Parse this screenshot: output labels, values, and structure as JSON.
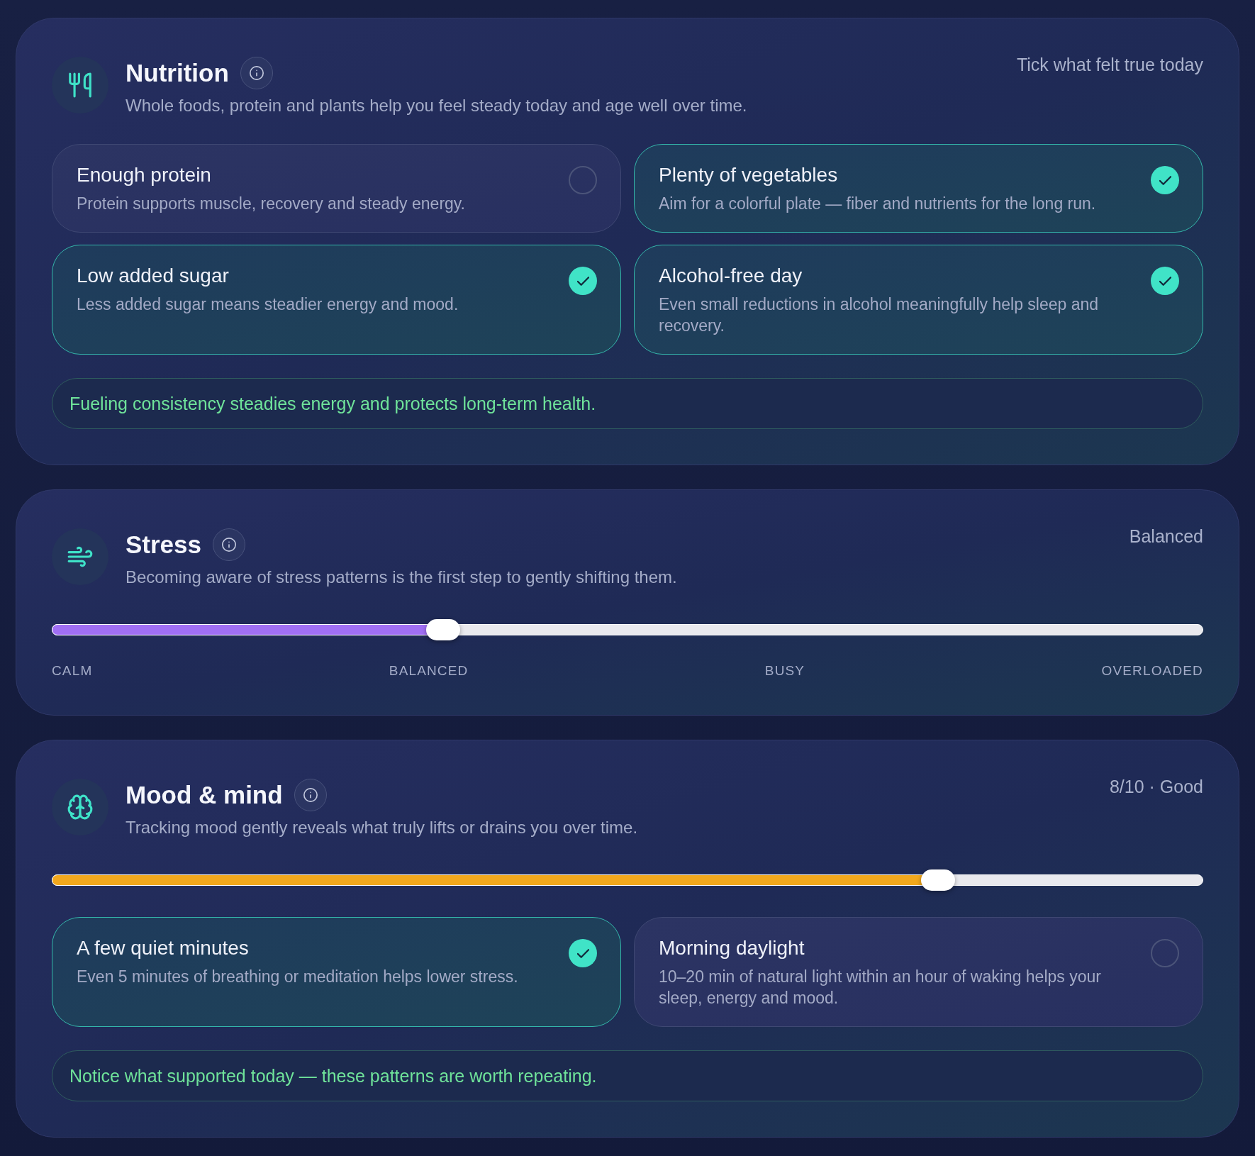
{
  "sections": [
    {
      "title": "Nutrition",
      "subtitle": "Whole foods, protein and plants help you feel steady today and age well over time.",
      "status": "Tick what felt true today",
      "items": [
        {
          "title": "Enough protein",
          "description": "Protein supports muscle, recovery and steady energy.",
          "checked": false
        },
        {
          "title": "Plenty of vegetables",
          "description": "Aim for a colorful plate — fiber and nutrients for the long run.",
          "checked": true
        },
        {
          "title": "Low added sugar",
          "description": "Less added sugar means steadier energy and mood.",
          "checked": true
        },
        {
          "title": "Alcohol-free day",
          "description": "Even small reductions in alcohol meaningfully help sleep and recovery.",
          "checked": true
        }
      ],
      "tip": "Fueling consistency steadies energy and protects long-term health."
    },
    {
      "title": "Stress",
      "subtitle": "Becoming aware of stress patterns is the first step to gently shifting them.",
      "status": "Balanced",
      "slider": {
        "level": 0.34,
        "color": "#a06ff4"
      },
      "scale_labels": [
        "CALM",
        "BALANCED",
        "BUSY",
        "OVERLOADED"
      ]
    },
    {
      "title": "Mood & mind",
      "subtitle": "Tracking mood gently reveals what truly lifts or drains you over time.",
      "status": "8/10 · Good",
      "slider": {
        "level": 0.77,
        "color": "#f2a81d"
      },
      "items": [
        {
          "title": "A few quiet minutes",
          "description": "Even 5 minutes of breathing or meditation helps lower stress.",
          "checked": true
        },
        {
          "title": "Morning daylight",
          "description": "10–20 min of natural light within an hour of waking helps your sleep, energy and mood.",
          "checked": false
        }
      ],
      "tip": "Notice what supported today — these patterns are worth repeating."
    }
  ]
}
